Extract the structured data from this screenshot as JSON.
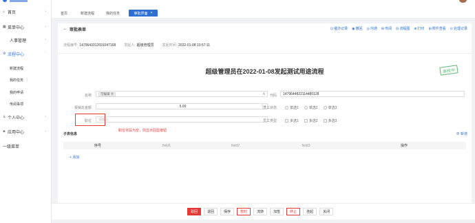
{
  "sidebar": {
    "items": [
      {
        "icon": "home-icon",
        "glyph": "⌂",
        "label": "首页"
      },
      {
        "icon": "grid-icon",
        "glyph": "▦",
        "label": "菜单中心"
      },
      {
        "icon": "user-icon",
        "glyph": "",
        "label": "人事管理"
      },
      {
        "icon": "flow-icon",
        "glyph": "⚙",
        "label": "流程中心"
      },
      {
        "icon": "person-icon",
        "glyph": "♙",
        "label": "个人中心"
      },
      {
        "icon": "app-icon",
        "glyph": "◈",
        "label": "应用中心"
      },
      {
        "icon": "",
        "glyph": "",
        "label": "一级菜单"
      }
    ],
    "sub_items": [
      "新建流程",
      "我的任务",
      "我的申请",
      "传阅事项"
    ]
  },
  "tabs": [
    {
      "label": "首页"
    },
    {
      "label": "新建流程"
    },
    {
      "label": "我的任务"
    },
    {
      "label": "审批界面",
      "close": "×"
    }
  ],
  "panel": {
    "back_glyph": "←",
    "title": "审批表单",
    "actions": [
      {
        "icon": "log-icon",
        "glyph": "⊡",
        "label": "催办记录"
      },
      {
        "icon": "return-icon",
        "glyph": "◉",
        "label": "撤回"
      },
      {
        "icon": "chat-icon",
        "glyph": "◎",
        "label": "沟通"
      },
      {
        "icon": "circulate-icon",
        "glyph": "⊞",
        "label": "传阅"
      },
      {
        "icon": "diagram-icon",
        "glyph": "⊟",
        "label": "流程图"
      },
      {
        "icon": "print-icon",
        "glyph": "⊕",
        "label": "打印"
      },
      {
        "icon": "attach-icon",
        "glyph": "⊞",
        "label": "附件查看"
      },
      {
        "icon": "history-icon",
        "glyph": "⊙",
        "label": "处理记录"
      }
    ],
    "meta": {
      "flow_no_label": "流程编号:",
      "flow_no": "1479643312691047168",
      "creator_label": "发起人:",
      "creator": "超级管理员",
      "time_label": "发起时间:",
      "time": "2022-01-08 10:57:11"
    },
    "doc_title": "超级管理员在2022-01-08发起测试用途流程",
    "stamp": "审核中",
    "form": {
      "name_label": "名称",
      "name_chip": "可编辑 ⊗",
      "name_suffix": "A",
      "amount_label": "报销总金额",
      "amount": "5.00",
      "position_label": "职位",
      "position_placeholder": "请输入",
      "code_label": "代码",
      "code": "1479644822114480128",
      "status_label": "员工状态",
      "status_options": [
        "单选1",
        "单选2",
        "单选3"
      ],
      "type_label": "员工类型",
      "type_options": [
        "多选1",
        "多选2",
        "多选3"
      ]
    },
    "note": "职位字段为空，则显示回显按钮",
    "subtable": {
      "title": "子表信息",
      "add_top": "⊕ 新增",
      "headers": [
        "序号",
        "field1",
        "field2",
        "field3",
        "操作"
      ],
      "add_link": "+ 添加"
    }
  },
  "footer": {
    "buttons": [
      {
        "label": "驳回",
        "style": "primary"
      },
      {
        "label": "退回",
        "style": ""
      },
      {
        "label": "保存",
        "style": ""
      },
      {
        "label": "暂时",
        "style": "danger"
      },
      {
        "label": "流转",
        "style": ""
      },
      {
        "label": "加签",
        "style": ""
      },
      {
        "label": "终止",
        "style": "danger"
      },
      {
        "label": "挂起",
        "style": ""
      },
      {
        "label": "关闭",
        "style": ""
      }
    ]
  }
}
